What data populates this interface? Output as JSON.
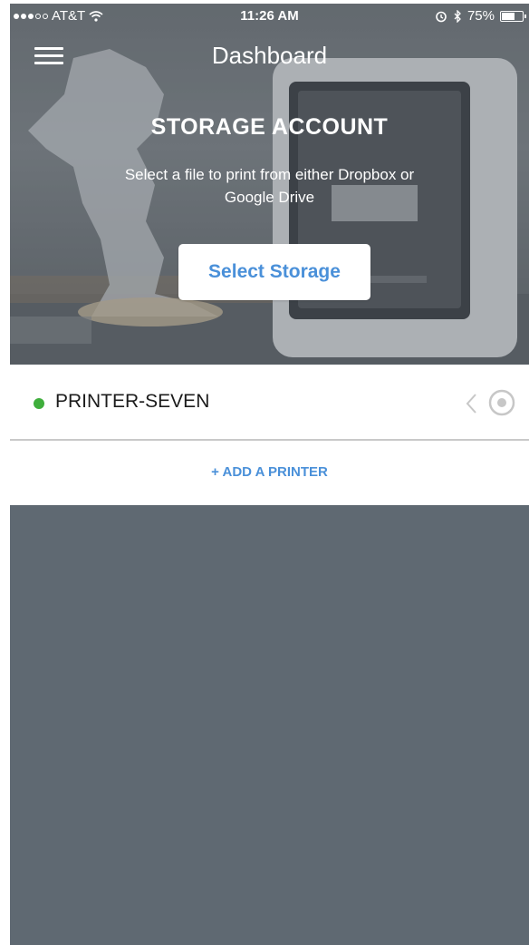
{
  "status_bar": {
    "carrier": "AT&T",
    "time": "11:26 AM",
    "battery": "75%",
    "battery_level": 0.75
  },
  "nav": {
    "title": "Dashboard",
    "menu_icon": "hamburger-menu-icon"
  },
  "hero": {
    "heading": "STORAGE ACCOUNT",
    "subtitle": "Select a file to print from either Dropbox or Google Drive",
    "button_label": "Select Storage"
  },
  "printers": [
    {
      "name": "PRINTER-SEVEN",
      "status_color": "#3fae3c",
      "status": "online"
    }
  ],
  "add_printer": {
    "label": "+ ADD A PRINTER"
  },
  "colors": {
    "accent": "#4a90d9",
    "background": "#5f6972",
    "online": "#3fae3c"
  },
  "icons": [
    "wifi-icon",
    "alarm-icon",
    "bluetooth-icon",
    "battery-icon",
    "chevron-left-icon",
    "gear-icon"
  ]
}
